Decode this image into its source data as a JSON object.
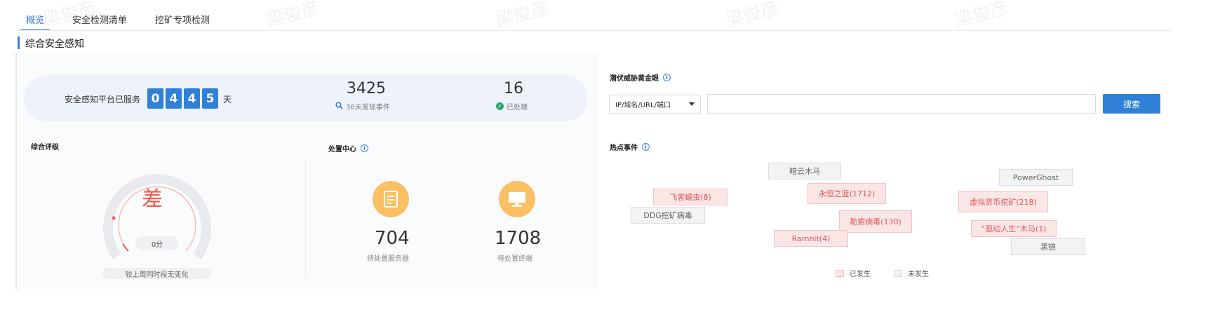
{
  "tabs": [
    {
      "label": "概览",
      "active": true
    },
    {
      "label": "安全检测清单",
      "active": false
    },
    {
      "label": "挖矿专项检测",
      "active": false
    }
  ],
  "section_title": "综合安全感知",
  "summary": {
    "service_prefix": "安全感知平台已服务",
    "digits": [
      "0",
      "4",
      "4",
      "5"
    ],
    "service_suffix": "天",
    "events_count": "3425",
    "events_label": "30天发现事件",
    "handled_count": "16",
    "handled_label": "已处理"
  },
  "rating": {
    "title": "综合评级",
    "grade": "差",
    "score": "0分",
    "compare": "较上周同时段无变化"
  },
  "disposal": {
    "title": "处置中心",
    "servers_count": "704",
    "servers_label": "待处置服务器",
    "terminals_count": "1708",
    "terminals_label": "待处置终端"
  },
  "gold_eye": {
    "title": "潜伏威胁黄金眼",
    "select_value": "IP/域名/URL/端口",
    "search_value": "",
    "search_button": "搜索"
  },
  "hot_events": {
    "title": "热点事件",
    "tags": [
      {
        "label": "暗云木马",
        "status": "off"
      },
      {
        "label": "PowerGhost",
        "status": "off"
      },
      {
        "label": "飞客蠕虫(8)",
        "status": "on"
      },
      {
        "label": "永恒之蓝(1712)",
        "status": "on"
      },
      {
        "label": "虚拟货币挖矿(218)",
        "status": "on"
      },
      {
        "label": "DDG挖矿病毒",
        "status": "off"
      },
      {
        "label": "勒索病毒(130)",
        "status": "on"
      },
      {
        "label": "“驱动人生”木马(1)",
        "status": "on"
      },
      {
        "label": "Ramnit(4)",
        "status": "on"
      },
      {
        "label": "黑链",
        "status": "off"
      }
    ],
    "legend_on": "已发生",
    "legend_off": "未发生"
  },
  "colors": {
    "accent": "#2f80d6",
    "occurred": "#e05555",
    "gauge_red": "#f05a4a",
    "icon_orange": "#fbc064"
  },
  "watermark": "梁俊彦"
}
